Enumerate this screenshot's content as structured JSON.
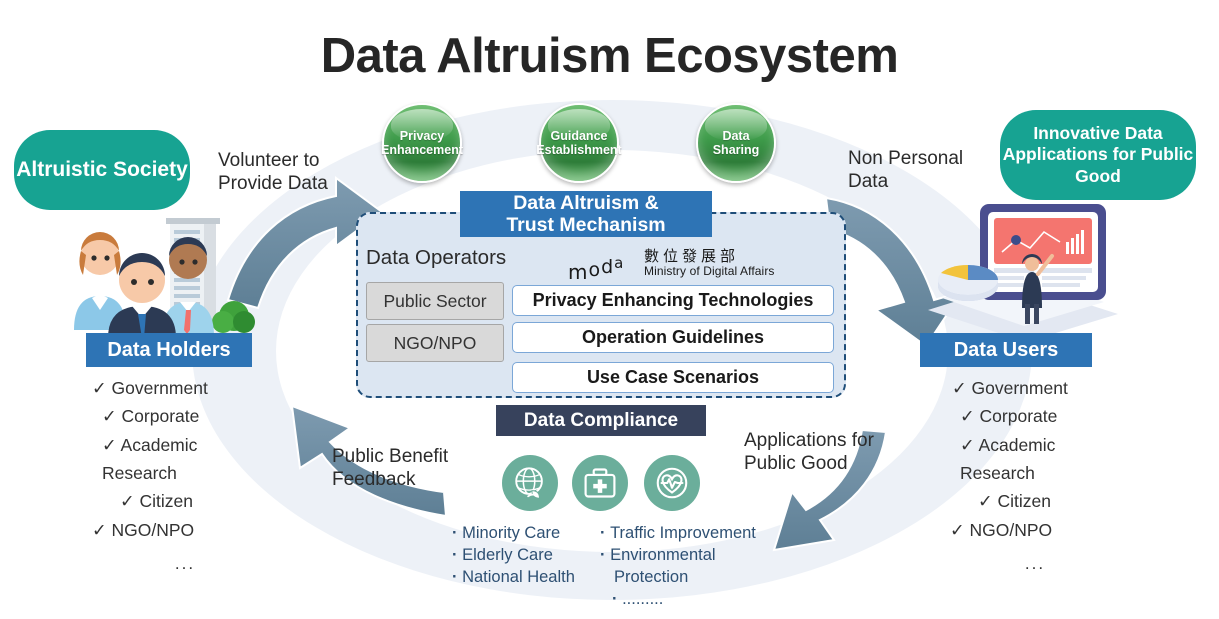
{
  "title": "Data Altruism Ecosystem",
  "top_circles": [
    {
      "label": "Privacy\nEnhancement",
      "name": "privacy-enhancement"
    },
    {
      "label": "Guidance\nEstablishment",
      "name": "guidance-establishment"
    },
    {
      "label": "Data\nSharing",
      "name": "data-sharing"
    }
  ],
  "left": {
    "pill": "Altruistic\nSociety",
    "bar": "Data Holders",
    "items": [
      "✓ Government",
      "✓ Corporate",
      "✓ Academic\n     Research",
      "✓ Citizen",
      "✓ NGO/NPO"
    ],
    "ellipsis": "..."
  },
  "right": {
    "pill": "Innovative Data\nApplications  for\nPublic Good",
    "bar": "Data Users",
    "items": [
      "✓ Government",
      "✓ Corporate",
      "✓ Academic\n     Research",
      "✓ Citizen",
      "✓ NGO/NPO"
    ],
    "ellipsis": "..."
  },
  "arrows": {
    "volunteer": "Volunteer to\nProvide Data",
    "non_personal": "Non Personal\nData",
    "feedback": "Public Benefit\nFeedback",
    "applications": "Applications for\nPublic Good"
  },
  "center": {
    "heading": "Data Altruism &\nTrust Mechanism",
    "operators_label": "Data Operators",
    "logo": {
      "word": "moda",
      "chinese": "數位發展部",
      "english": "Ministry of Digital Affairs"
    },
    "operator_chips": [
      "Public Sector",
      "NGO/NPO"
    ],
    "boxes": [
      "Privacy Enhancing Technologies",
      "Operation Guidelines",
      "Use Case  Scenarios"
    ]
  },
  "compliance": {
    "heading": "Data Compliance",
    "icons": [
      "globe-leaf-icon",
      "medical-kit-icon",
      "heart-pulse-icon"
    ],
    "left_bullets": [
      "Minority Care",
      "Elderly Care",
      "National Health"
    ],
    "right_bullets": [
      "Traffic Improvement",
      "Environmental",
      "Protection",
      "........."
    ]
  },
  "colors": {
    "teal": "#17A392",
    "blue": "#2E74B5",
    "navy": "#37425C",
    "green": "#3E9B4A",
    "arrow": "#6B8CA3",
    "ellipse_bg": "#EDF1F7",
    "dash_border": "#1F4E79",
    "dash_fill": "#DCE6F2",
    "icon_teal": "#6BAE9B",
    "bullet_text": "#2E5073"
  }
}
